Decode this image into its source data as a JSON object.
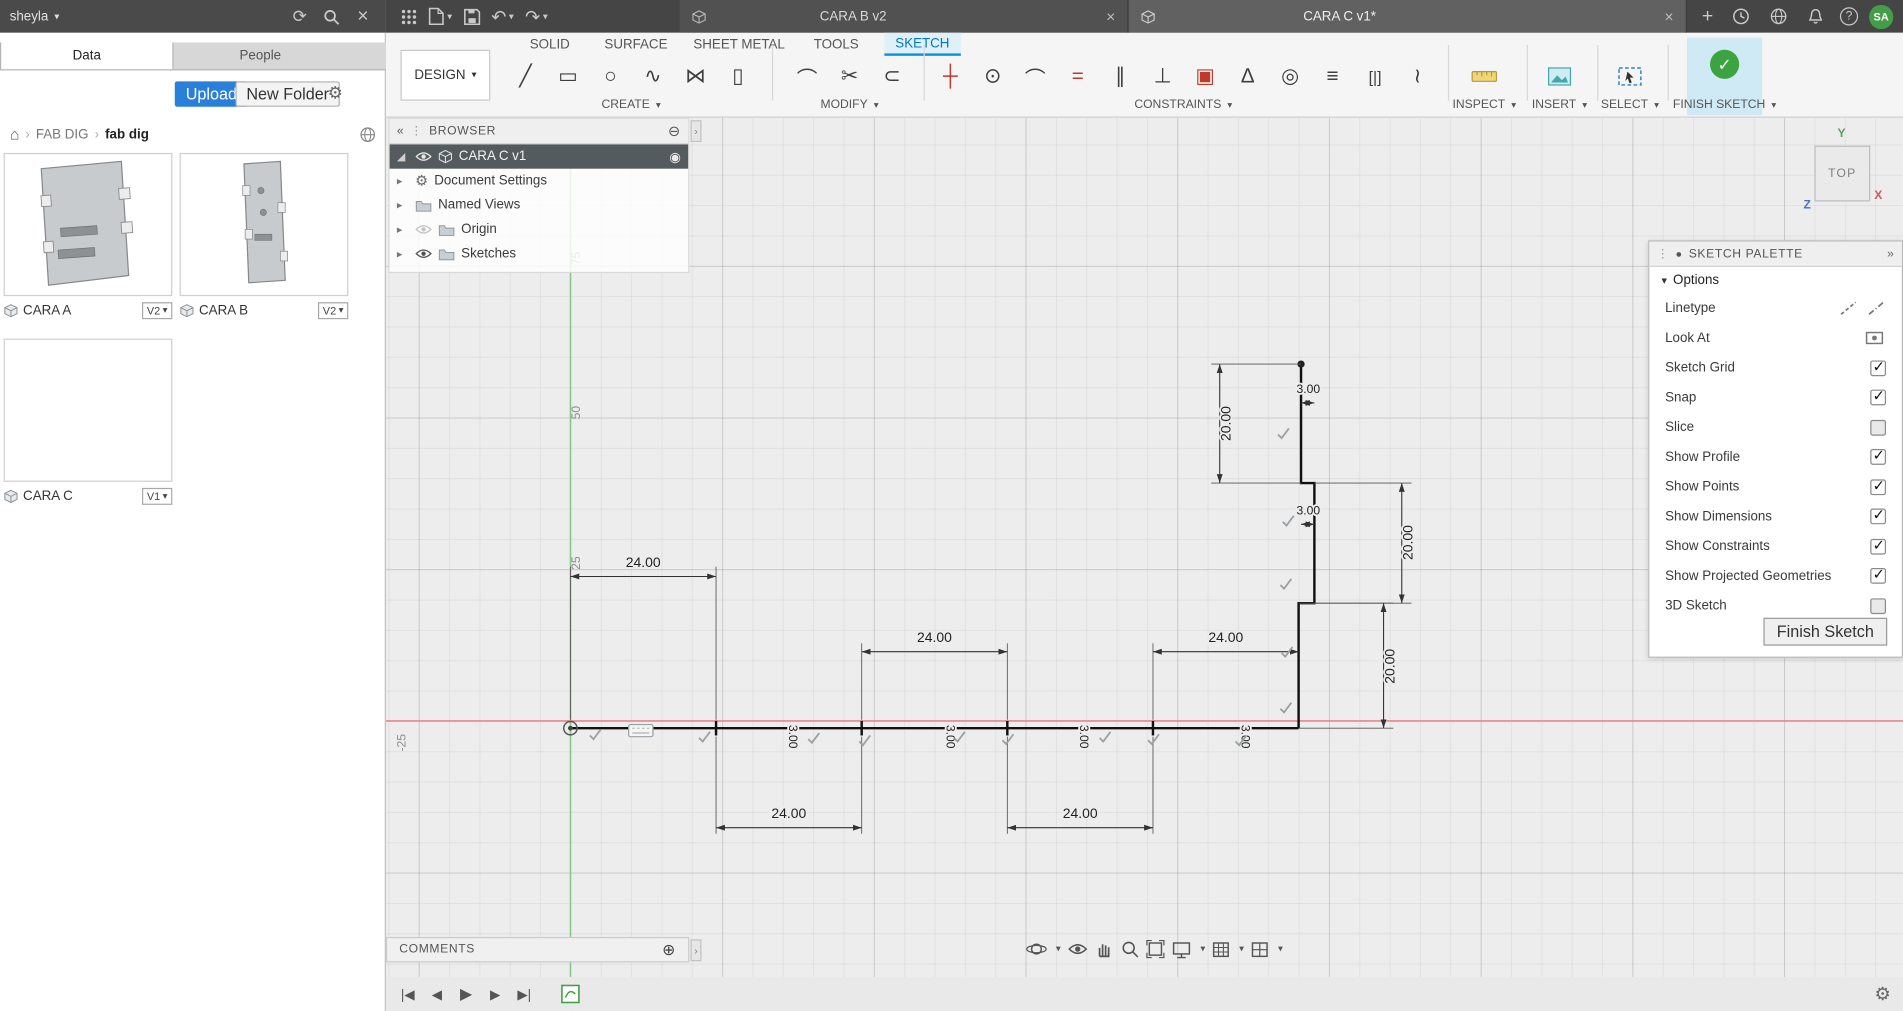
{
  "colors": {
    "accent_blue": "#0696d7",
    "upload_blue": "#2a80d8",
    "finish_green": "#3ba33f",
    "selected_row": "#545b5f",
    "axis_x_red": "#e48a8a",
    "axis_y_green": "#86c986",
    "avatar_green": "#449d48"
  },
  "icons": {
    "caret": "▾",
    "refresh": "⟳",
    "close": "×",
    "undo": "↶",
    "redo": "↷",
    "plus": "+",
    "home": "⌂",
    "chevron": "›",
    "dock_left": "«",
    "pin_right": "»",
    "grip": "⋮",
    "collapse_circle": "⊖",
    "add_comment": "⊕",
    "radio": "◉",
    "gear": "⚙",
    "expander": "▸",
    "expander_open": "◢",
    "help": "?",
    "line": "╱",
    "rectangle": "▭",
    "circle": "○",
    "spline": "∿",
    "mirror": "⋈",
    "slot": "▯",
    "fillet": "⌒",
    "trim": "✂",
    "offset": "⊂",
    "hv": "┼",
    "coincident": "⊙",
    "tangent": "⌒",
    "equal": "=",
    "parallel": "∥",
    "perpendicular": "⊥",
    "fix": "▣",
    "midpoint": "∆",
    "concentric": "◎",
    "collinear": "≡",
    "symmetry": "[|]",
    "curvature": "≀",
    "skip_start": "|◀",
    "step_back": "◀",
    "play": "▶",
    "step_fwd": "▶",
    "skip_end": "▶|"
  },
  "left_bar": {
    "user": "sheyla"
  },
  "data_panel": {
    "tabs": [
      {
        "label": "Data"
      },
      {
        "label": "People"
      }
    ],
    "upload": "Upload",
    "new_folder": "New Folder",
    "breadcrumb": {
      "project": "FAB DIG",
      "folder": "fab dig"
    },
    "items": [
      {
        "name": "CARA A",
        "version": "V2"
      },
      {
        "name": "CARA B",
        "version": "V2"
      },
      {
        "name": "CARA C",
        "version": "V1"
      }
    ]
  },
  "top_bar": {
    "tabs": [
      {
        "label": "CARA B v2"
      },
      {
        "label": "CARA C v1*"
      }
    ],
    "avatar": "SA"
  },
  "ribbon": {
    "workspace": "DESIGN",
    "context_tabs": [
      {
        "label": "SOLID"
      },
      {
        "label": "SURFACE"
      },
      {
        "label": "SHEET METAL"
      },
      {
        "label": "TOOLS"
      },
      {
        "label": "SKETCH"
      }
    ],
    "active_tab": "SKETCH",
    "groups": {
      "create": "CREATE",
      "modify": "MODIFY",
      "constraints": "CONSTRAINTS",
      "inspect": "INSPECT",
      "insert": "INSERT",
      "select": "SELECT",
      "finish": "FINISH SKETCH"
    }
  },
  "browser": {
    "title": "BROWSER",
    "root": "CARA C v1",
    "items": [
      {
        "label": "Document Settings"
      },
      {
        "label": "Named Views"
      },
      {
        "label": "Origin"
      },
      {
        "label": "Sketches"
      }
    ]
  },
  "viewcube": {
    "face": "TOP",
    "x": "X",
    "y": "Y",
    "z": "Z"
  },
  "canvas": {
    "grid_labels": {
      "y75": "75",
      "y50": "50",
      "y25": "25",
      "xm25": "-25"
    },
    "dims": {
      "d24": "24.00",
      "d20": "20.00",
      "d3": "3.00"
    }
  },
  "sketch_palette": {
    "title": "SKETCH PALETTE",
    "section": "Options",
    "rows": [
      {
        "label": "Linetype"
      },
      {
        "label": "Look At"
      },
      {
        "label": "Sketch Grid",
        "checked": true
      },
      {
        "label": "Snap",
        "checked": true
      },
      {
        "label": "Slice",
        "checked": false
      },
      {
        "label": "Show Profile",
        "checked": true
      },
      {
        "label": "Show Points",
        "checked": true
      },
      {
        "label": "Show Dimensions",
        "checked": true
      },
      {
        "label": "Show Constraints",
        "checked": true
      },
      {
        "label": "Show Projected Geometries",
        "checked": true
      },
      {
        "label": "3D Sketch",
        "checked": false
      }
    ],
    "finish": "Finish Sketch"
  },
  "comments": {
    "title": "COMMENTS"
  }
}
